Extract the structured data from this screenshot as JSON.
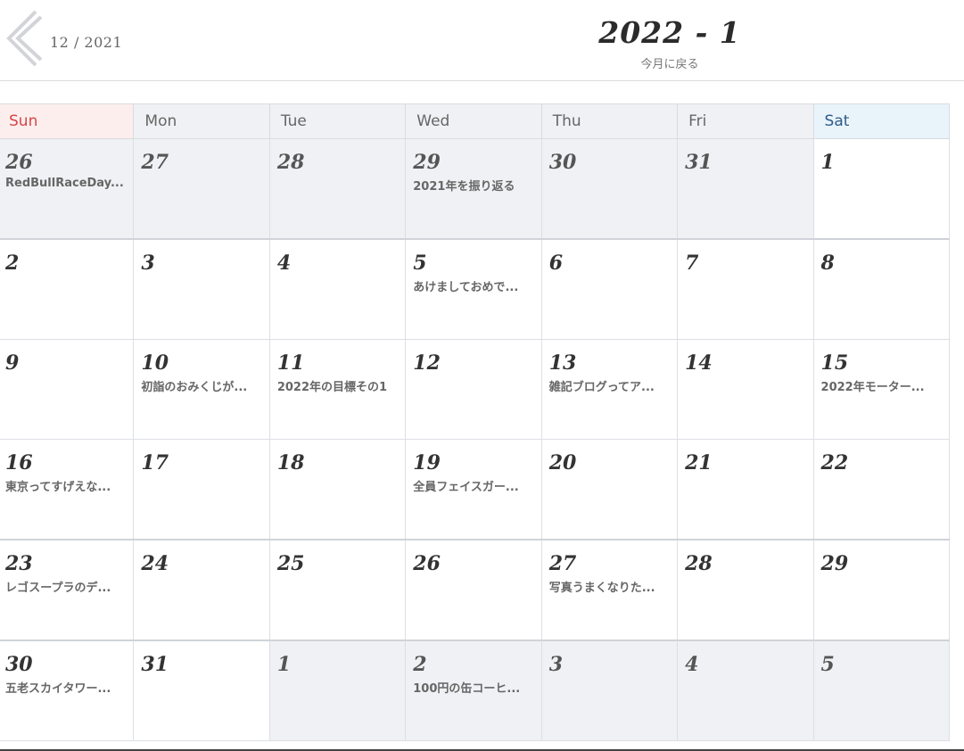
{
  "header": {
    "prev_label": "12 / 2021",
    "title": "2022 - 1",
    "today_link": "今月に戻る"
  },
  "weekdays": [
    "Sun",
    "Mon",
    "Tue",
    "Wed",
    "Thu",
    "Fri",
    "Sat"
  ],
  "weeks": [
    [
      {
        "day": "26",
        "other": true,
        "event": "RedBullRaceDay..."
      },
      {
        "day": "27",
        "other": true,
        "event": ""
      },
      {
        "day": "28",
        "other": true,
        "event": ""
      },
      {
        "day": "29",
        "other": true,
        "event": "2021年を振り返る"
      },
      {
        "day": "30",
        "other": true,
        "event": ""
      },
      {
        "day": "31",
        "other": true,
        "event": ""
      },
      {
        "day": "1",
        "other": false,
        "event": ""
      }
    ],
    [
      {
        "day": "2",
        "other": false,
        "event": ""
      },
      {
        "day": "3",
        "other": false,
        "event": ""
      },
      {
        "day": "4",
        "other": false,
        "event": ""
      },
      {
        "day": "5",
        "other": false,
        "event": "あけましておめで..."
      },
      {
        "day": "6",
        "other": false,
        "event": ""
      },
      {
        "day": "7",
        "other": false,
        "event": ""
      },
      {
        "day": "8",
        "other": false,
        "event": ""
      }
    ],
    [
      {
        "day": "9",
        "other": false,
        "event": ""
      },
      {
        "day": "10",
        "other": false,
        "event": "初詣のおみくじが..."
      },
      {
        "day": "11",
        "other": false,
        "event": "2022年の目標その1"
      },
      {
        "day": "12",
        "other": false,
        "event": ""
      },
      {
        "day": "13",
        "other": false,
        "event": "雑記ブログってア..."
      },
      {
        "day": "14",
        "other": false,
        "event": ""
      },
      {
        "day": "15",
        "other": false,
        "event": "2022年モーター..."
      }
    ],
    [
      {
        "day": "16",
        "other": false,
        "event": "東京ってすげえな..."
      },
      {
        "day": "17",
        "other": false,
        "event": ""
      },
      {
        "day": "18",
        "other": false,
        "event": ""
      },
      {
        "day": "19",
        "other": false,
        "event": "全員フェイスガー..."
      },
      {
        "day": "20",
        "other": false,
        "event": ""
      },
      {
        "day": "21",
        "other": false,
        "event": ""
      },
      {
        "day": "22",
        "other": false,
        "event": ""
      }
    ],
    [
      {
        "day": "23",
        "other": false,
        "event": "レゴスープラのデ..."
      },
      {
        "day": "24",
        "other": false,
        "event": ""
      },
      {
        "day": "25",
        "other": false,
        "event": ""
      },
      {
        "day": "26",
        "other": false,
        "event": ""
      },
      {
        "day": "27",
        "other": false,
        "event": "写真うまくなりた..."
      },
      {
        "day": "28",
        "other": false,
        "event": ""
      },
      {
        "day": "29",
        "other": false,
        "event": ""
      }
    ],
    [
      {
        "day": "30",
        "other": false,
        "event": "五老スカイタワー..."
      },
      {
        "day": "31",
        "other": false,
        "event": ""
      },
      {
        "day": "1",
        "other": true,
        "event": ""
      },
      {
        "day": "2",
        "other": true,
        "event": "100円の缶コーヒ..."
      },
      {
        "day": "3",
        "other": true,
        "event": ""
      },
      {
        "day": "4",
        "other": true,
        "event": ""
      },
      {
        "day": "5",
        "other": true,
        "event": ""
      }
    ]
  ]
}
